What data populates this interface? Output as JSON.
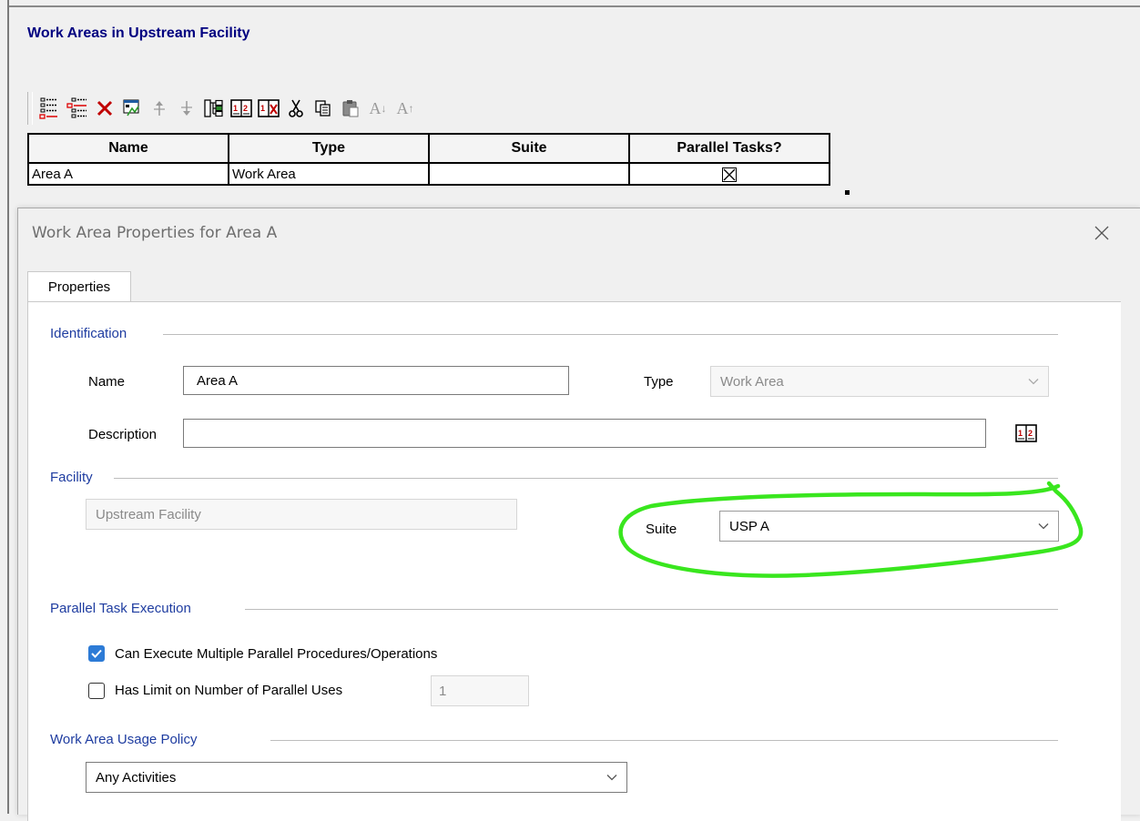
{
  "window": {
    "title": "Work Areas in Upstream Facility"
  },
  "toolbar": {
    "buttons": [
      {
        "name": "add-item",
        "icon": "list-add-icon"
      },
      {
        "name": "insert-item",
        "icon": "list-insert-icon"
      },
      {
        "name": "delete",
        "icon": "delete-x-icon"
      },
      {
        "name": "properties",
        "icon": "properties-icon"
      },
      {
        "name": "move-up",
        "icon": "move-up-icon"
      },
      {
        "name": "move-down",
        "icon": "move-down-icon"
      },
      {
        "name": "hierarchy",
        "icon": "hierarchy-icon"
      },
      {
        "name": "book-1",
        "icon": "book-icon"
      },
      {
        "name": "book-2",
        "icon": "book-delete-icon"
      },
      {
        "name": "cut",
        "icon": "cut-icon"
      },
      {
        "name": "copy",
        "icon": "copy-icon"
      },
      {
        "name": "paste",
        "icon": "paste-icon"
      },
      {
        "name": "font-decrease",
        "icon": "font-decrease-icon",
        "glyph": "A↓"
      },
      {
        "name": "font-increase",
        "icon": "font-increase-icon",
        "glyph": "A↑"
      }
    ]
  },
  "grid": {
    "columns": [
      "Name",
      "Type",
      "Suite",
      "Parallel Tasks?"
    ],
    "rows": [
      {
        "name": "Area A",
        "type": "Work Area",
        "suite": "",
        "parallel": true
      }
    ]
  },
  "dialog": {
    "title": "Work Area Properties for Area A",
    "tab": "Properties",
    "identification": {
      "group_label": "Identification",
      "name_label": "Name",
      "name_value": "Area A",
      "type_label": "Type",
      "type_value": "Work Area",
      "description_label": "Description",
      "description_value": ""
    },
    "facility": {
      "group_label": "Facility",
      "facility_value": "Upstream Facility",
      "suite_label": "Suite",
      "suite_value": "USP A"
    },
    "parallel": {
      "group_label": "Parallel Task Execution",
      "multi_label": "Can Execute Multiple Parallel Procedures/Operations",
      "multi_checked": true,
      "limit_label": "Has Limit on Number of Parallel Uses",
      "limit_checked": false,
      "limit_value": "1"
    },
    "usage": {
      "group_label": "Work Area Usage Policy",
      "policy_value": "Any Activities"
    }
  },
  "colors": {
    "title_blue": "#000080",
    "group_blue": "#1e3ca0",
    "checkbox_blue": "#2d7bd6",
    "annotation_green": "#39e61e"
  }
}
